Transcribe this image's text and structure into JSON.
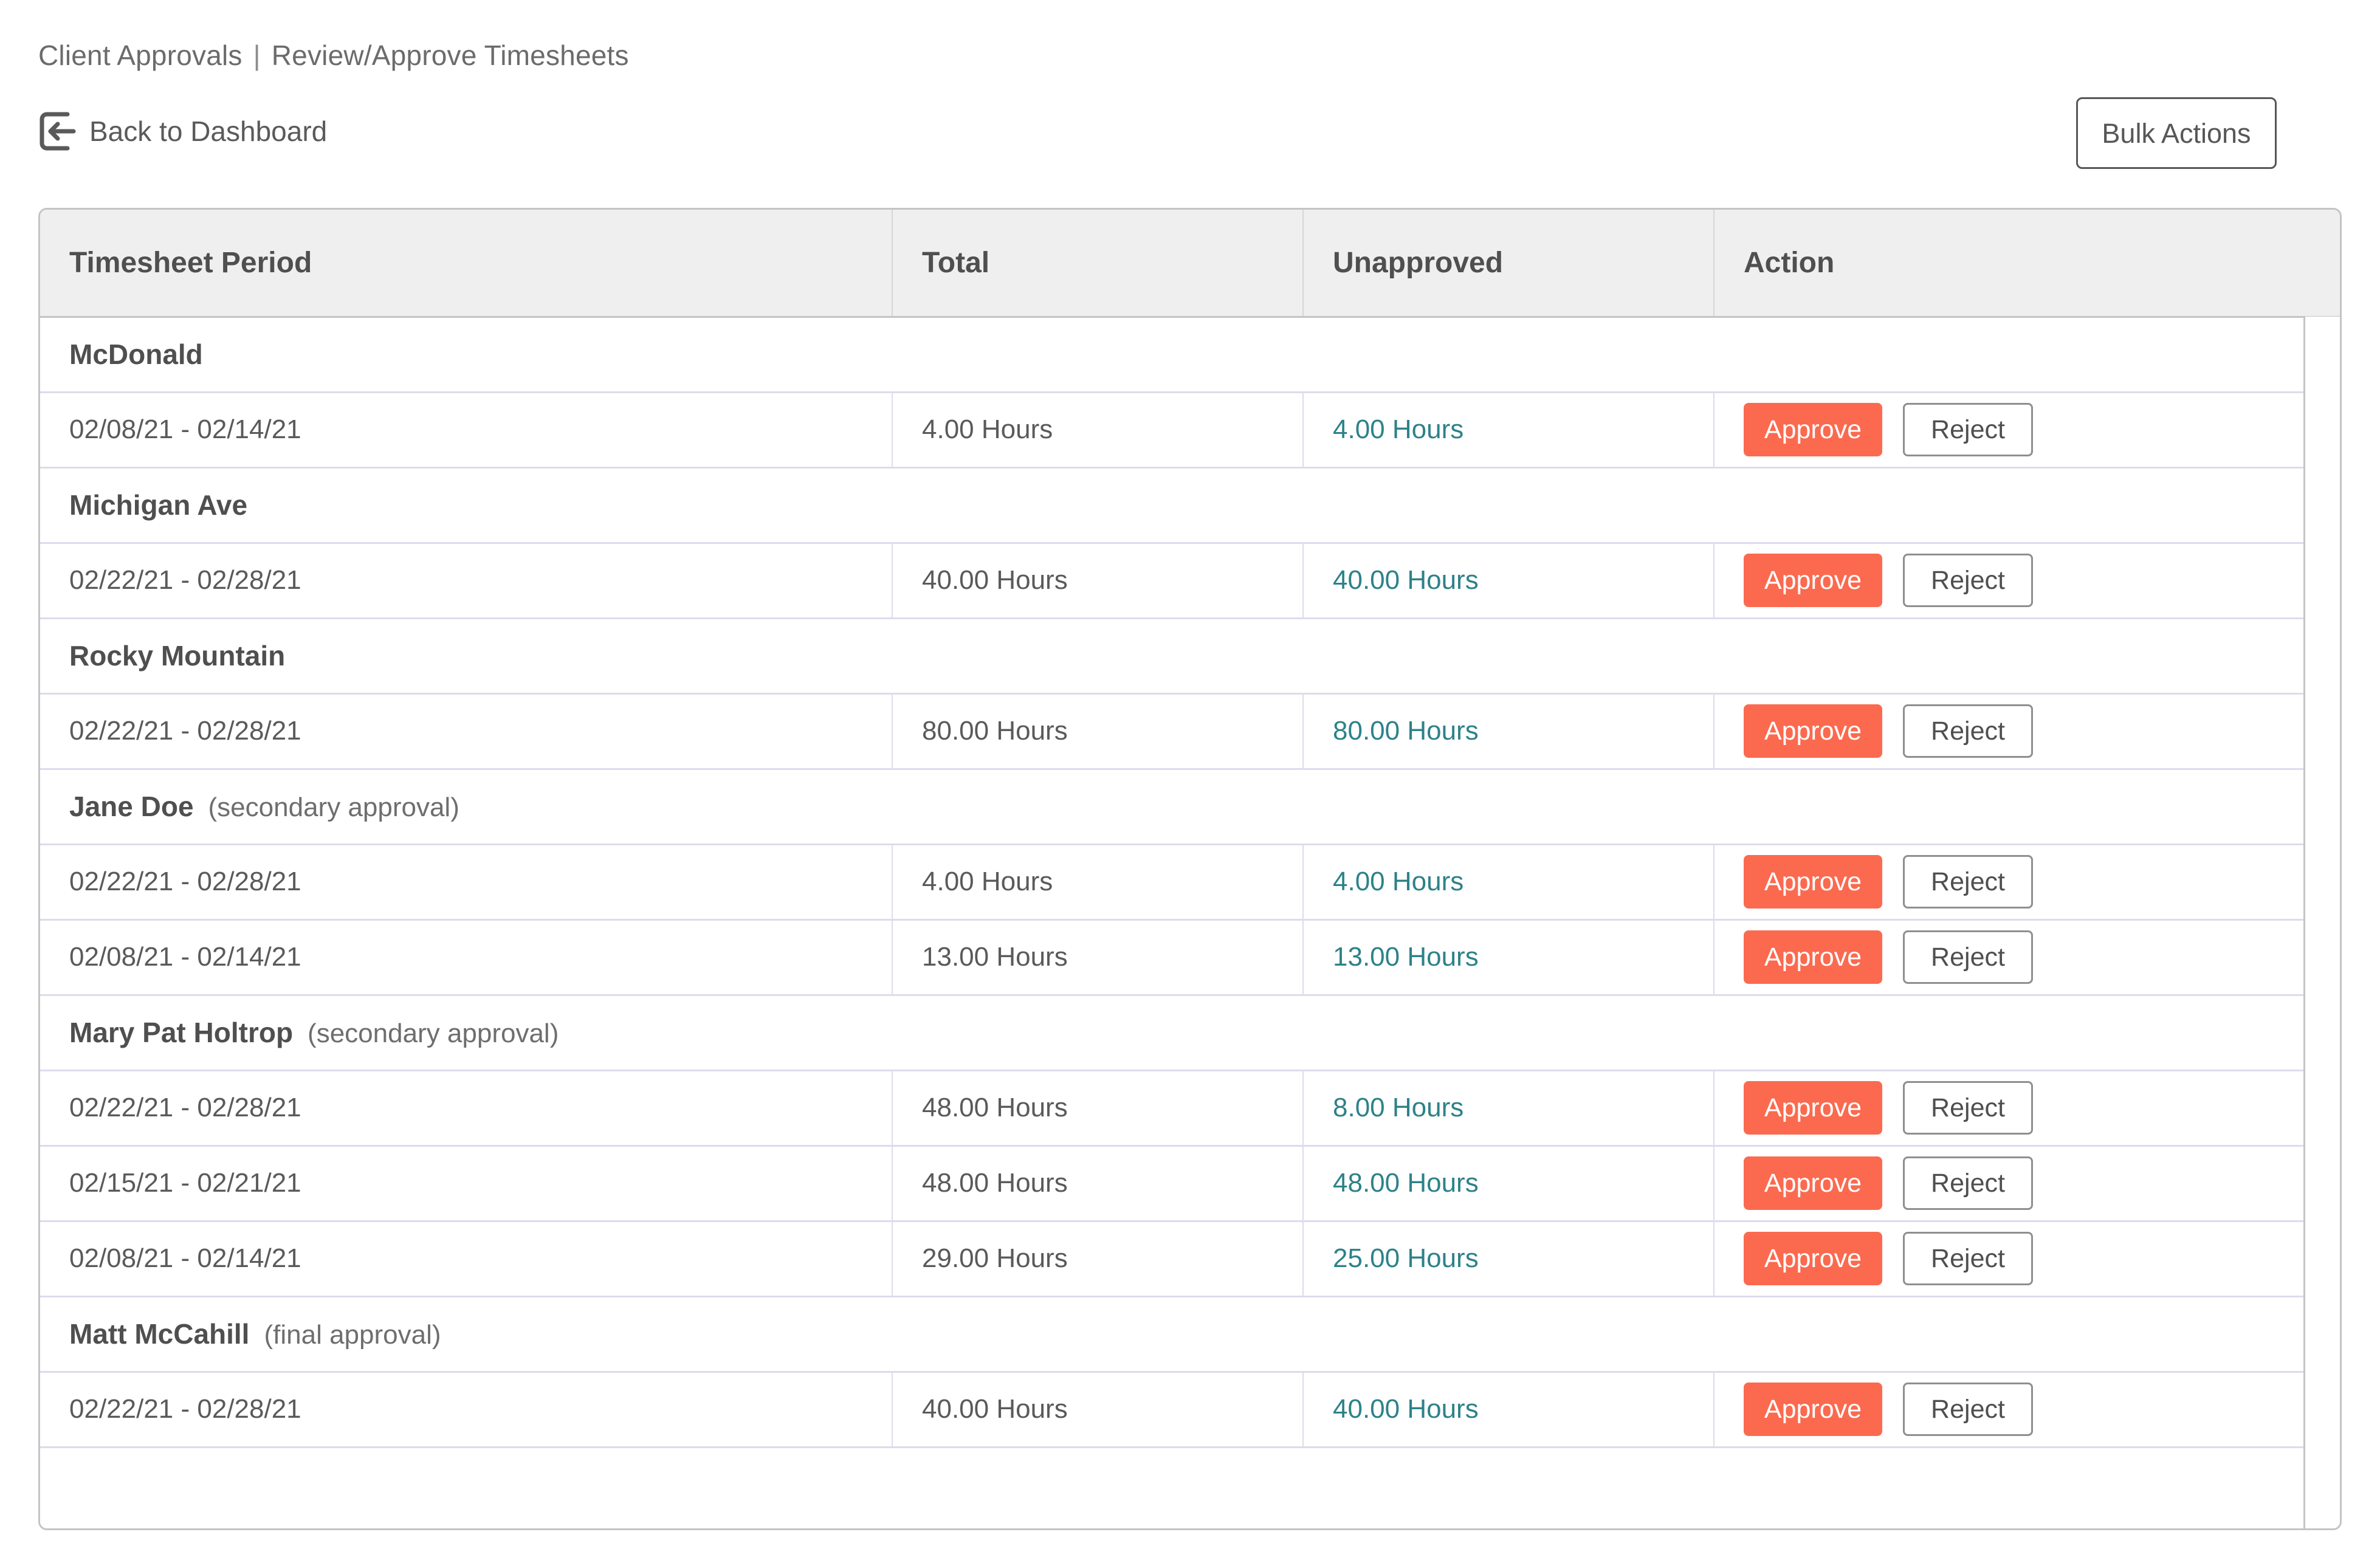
{
  "breadcrumb": {
    "parent": "Client Approvals",
    "separator": "|",
    "current": "Review/Approve Timesheets"
  },
  "back_link": {
    "label": "Back to Dashboard",
    "icon": "back-arrow-icon"
  },
  "toolbar": {
    "bulk_actions_label": "Bulk Actions"
  },
  "table": {
    "columns": [
      "Timesheet Period",
      "Total",
      "Unapproved",
      "Action"
    ],
    "buttons": {
      "approve": "Approve",
      "reject": "Reject"
    },
    "groups": [
      {
        "name": "McDonald",
        "note": "",
        "rows": [
          {
            "period": "02/08/21 - 02/14/21",
            "total": "4.00 Hours",
            "unapproved": "4.00 Hours"
          }
        ]
      },
      {
        "name": "Michigan Ave",
        "note": "",
        "rows": [
          {
            "period": "02/22/21 - 02/28/21",
            "total": "40.00 Hours",
            "unapproved": "40.00 Hours"
          }
        ]
      },
      {
        "name": "Rocky Mountain",
        "note": "",
        "rows": [
          {
            "period": "02/22/21 - 02/28/21",
            "total": "80.00 Hours",
            "unapproved": "80.00 Hours"
          }
        ]
      },
      {
        "name": "Jane Doe",
        "note": "(secondary approval)",
        "rows": [
          {
            "period": "02/22/21 - 02/28/21",
            "total": "4.00 Hours",
            "unapproved": "4.00 Hours"
          },
          {
            "period": "02/08/21 - 02/14/21",
            "total": "13.00 Hours",
            "unapproved": "13.00 Hours"
          }
        ]
      },
      {
        "name": "Mary Pat Holtrop",
        "note": "(secondary approval)",
        "rows": [
          {
            "period": "02/22/21 - 02/28/21",
            "total": "48.00 Hours",
            "unapproved": "8.00 Hours"
          },
          {
            "period": "02/15/21 - 02/21/21",
            "total": "48.00 Hours",
            "unapproved": "48.00 Hours"
          },
          {
            "period": "02/08/21 - 02/14/21",
            "total": "29.00 Hours",
            "unapproved": "25.00 Hours"
          }
        ]
      },
      {
        "name": "Matt McCahill",
        "note": "(final approval)",
        "rows": [
          {
            "period": "02/22/21 - 02/28/21",
            "total": "40.00 Hours",
            "unapproved": "40.00 Hours"
          }
        ]
      }
    ]
  },
  "colors": {
    "approve_button": "#fb6a4f",
    "unapproved_link": "#2d8289",
    "header_background": "#efeff0",
    "row_divider": "#dcdcec",
    "card_border": "#c4c4c4",
    "text": "#5a5a5a"
  }
}
